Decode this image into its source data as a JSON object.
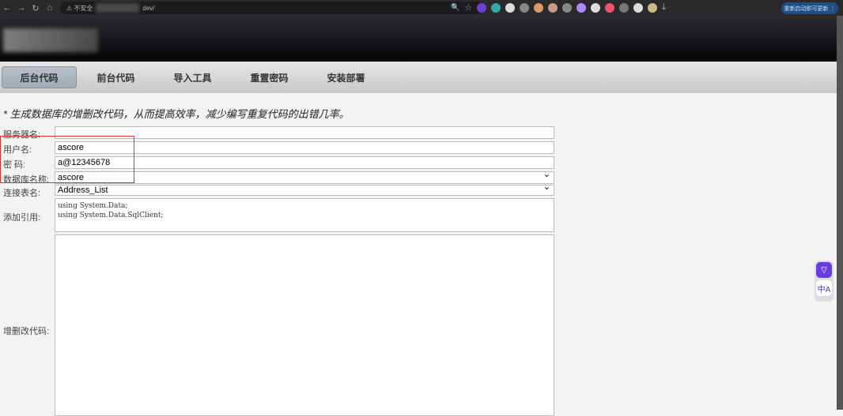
{
  "browser": {
    "url_prefix": "不安全",
    "url_suffix": "dev/",
    "update_button": "重新启动即可更新"
  },
  "nav": {
    "tabs": [
      {
        "label": "后台代码",
        "active": true
      },
      {
        "label": "前台代码"
      },
      {
        "label": "导入工具"
      },
      {
        "label": "重置密码"
      },
      {
        "label": "安装部署"
      }
    ]
  },
  "tip": "* 生成数据库的增删改代码，从而提高效率，减少编写重复代码的出错几率。",
  "form": {
    "server_label": "服务器名:",
    "server_value": "",
    "user_label": "用户名:",
    "user_value": "ascore",
    "password_label": "密 码:",
    "password_value": "a@12345678",
    "db_label": "数据库名称:",
    "db_value": "ascore",
    "table_label": "连接表名:",
    "table_value": "Address_List",
    "using_label": "添加引用:",
    "using_value": "using System.Data;\nusing System.Data.SqlClient;",
    "code_label": "增删改代码:",
    "code_value": ""
  },
  "side": {
    "translate_icon": "中A"
  }
}
